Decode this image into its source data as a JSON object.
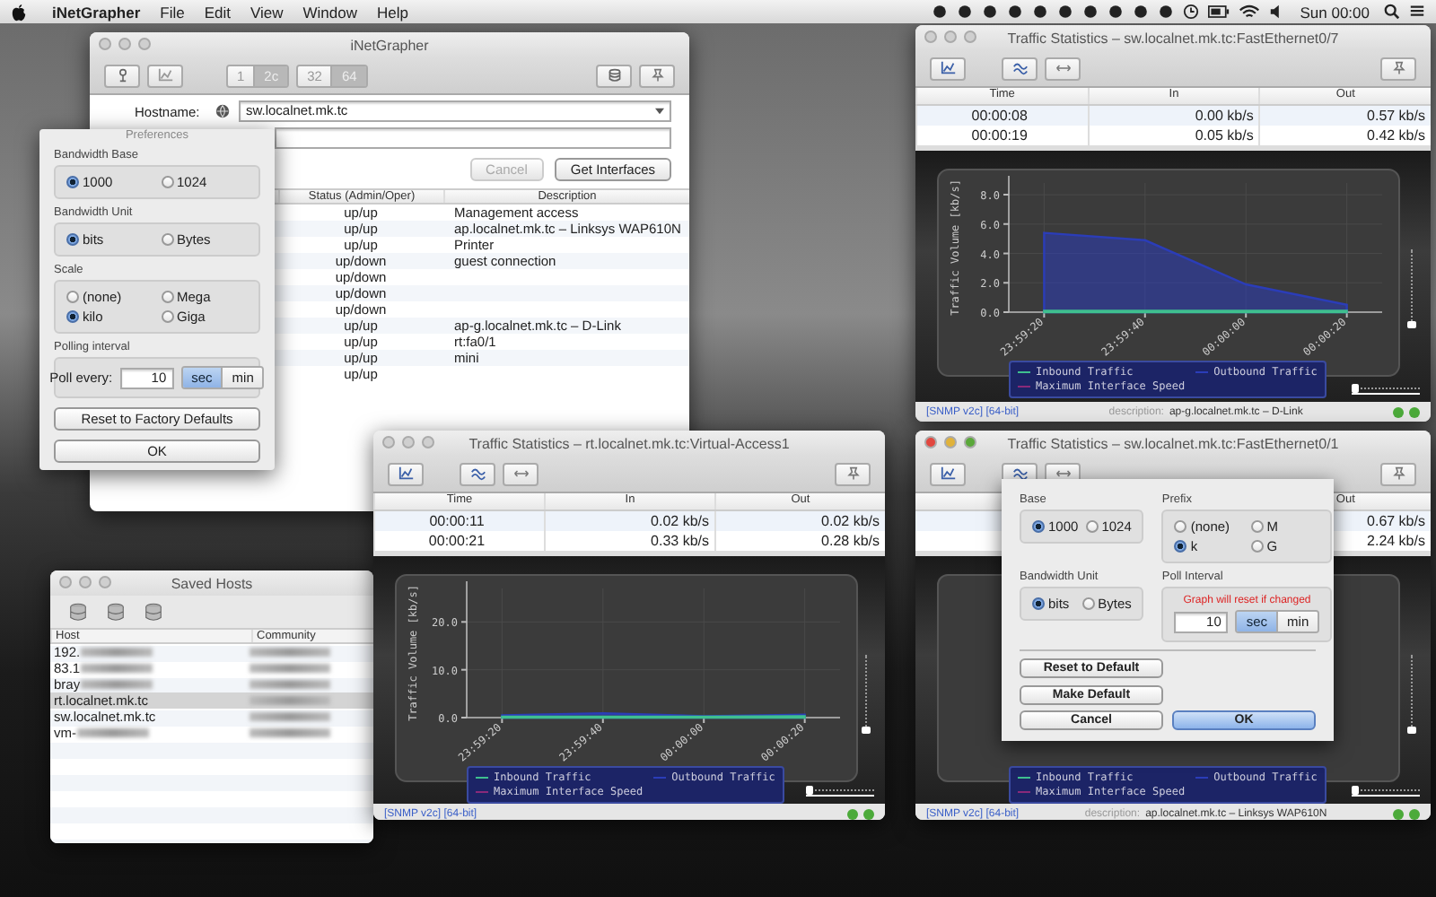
{
  "menu_bar": {
    "app_name": "iNetGrapher",
    "menus": [
      "File",
      "Edit",
      "View",
      "Window",
      "Help"
    ],
    "clock": "Sun 00:00"
  },
  "main_window": {
    "title": "iNetGrapher",
    "version_buttons": [
      {
        "label": "1",
        "selected": false
      },
      {
        "label": "2c",
        "selected": true
      }
    ],
    "bit_buttons": [
      {
        "label": "32",
        "selected": false
      },
      {
        "label": "64",
        "selected": true
      }
    ],
    "hostname_label": "Hostname:",
    "hostname": "sw.localnet.mk.tc",
    "buttons": [
      {
        "label": "Cancel",
        "disabled": true
      },
      {
        "label": "Get Interfaces",
        "disabled": false
      }
    ],
    "columns": [
      "Status (Admin/Oper)",
      "Description"
    ],
    "rows": [
      {
        "status": "up/up",
        "description": "Management access"
      },
      {
        "status": "up/up",
        "description": "ap.localnet.mk.tc – Linksys WAP610N"
      },
      {
        "status": "up/up",
        "description": "Printer"
      },
      {
        "status": "up/down",
        "description": "guest connection"
      },
      {
        "status": "up/down"
      },
      {
        "status": "up/down"
      },
      {
        "status": "up/down"
      },
      {
        "status": "up/up",
        "description": "ap-g.localnet.mk.tc – D-Link"
      },
      {
        "status": "up/up",
        "description": "rt:fa0/1"
      },
      {
        "status": "up/up",
        "description": "mini"
      },
      {
        "status": "up/up"
      }
    ]
  },
  "preferences": {
    "title": "Preferences",
    "groups": [
      {
        "kind": "radio",
        "title": "Bandwidth Base",
        "options": [
          {
            "label": "1000",
            "selected": true
          },
          {
            "label": "1024",
            "selected": false
          }
        ]
      },
      {
        "kind": "radio",
        "title": "Bandwidth Unit",
        "options": [
          {
            "label": "bits",
            "selected": true
          },
          {
            "label": "Bytes",
            "selected": false
          }
        ]
      },
      {
        "kind": "radio",
        "title": "Scale",
        "options": [
          {
            "label": "(none)",
            "selected": false
          },
          {
            "label": "Mega",
            "selected": false
          },
          {
            "label": "kilo",
            "selected": true
          },
          {
            "label": "Giga",
            "selected": false
          }
        ]
      },
      {
        "kind": "interval",
        "title": "Polling interval",
        "label": "Poll every:",
        "value": "10",
        "units": [
          {
            "label": "sec",
            "selected": true
          },
          {
            "label": "min",
            "selected": false
          }
        ]
      }
    ],
    "buttons": [
      "Reset to Factory Defaults",
      "OK"
    ]
  },
  "saved_hosts": {
    "title": "Saved Hosts",
    "columns": [
      "Host",
      "Community"
    ],
    "rows": [
      {
        "host": "192.",
        "host_blurred": true,
        "selected": false
      },
      {
        "host": "83.1",
        "host_blurred": true,
        "selected": false
      },
      {
        "host": "bray",
        "host_blurred": true,
        "selected": false
      },
      {
        "host": "rt.localnet.mk.tc",
        "host_blurred": false,
        "selected": true
      },
      {
        "host": "sw.localnet.mk.tc",
        "host_blurred": false,
        "selected": false
      },
      {
        "host": "vm-",
        "host_blurred": true,
        "selected": false
      }
    ]
  },
  "traffic_windows": [
    {
      "title": "Traffic Statistics – sw.localnet.mk.tc:FastEthernet0/7",
      "active": false,
      "columns": [
        "Time",
        "In",
        "Out"
      ],
      "rows": [
        [
          "00:00:08",
          "0.00 kb/s",
          "0.57 kb/s"
        ],
        [
          "00:00:19",
          "0.05 kb/s",
          "0.42 kb/s"
        ]
      ],
      "chart_data": {
        "type": "area",
        "ylabel": "Traffic Volume [kb/s]",
        "grid": true,
        "legend": "bottom",
        "categories": [
          "23:59:20",
          "23:59:40",
          "00:00:00",
          "00:00:20"
        ],
        "ylim": [
          0,
          8.8
        ],
        "yticks": [
          {
            "value": 0,
            "label": "0.0"
          },
          {
            "value": 2,
            "label": "2.0"
          },
          {
            "value": 4,
            "label": "4.0"
          },
          {
            "value": 6,
            "label": "6.0"
          },
          {
            "value": 8,
            "label": "8.0"
          }
        ],
        "series": [
          {
            "name": "Inbound Traffic",
            "color": "#3fbf8f",
            "values": [
              0.1,
              0.1,
              0.1,
              0.1
            ]
          },
          {
            "name": "Outbound Traffic",
            "color": "#2b3db8",
            "values": [
              5.4,
              4.9,
              1.9,
              0.5
            ]
          },
          {
            "name": "Maximum Interface Speed",
            "color": "#8a2a7a",
            "values": [
              null,
              null,
              null,
              null
            ]
          }
        ]
      },
      "vertical_slider": {
        "level": 0
      },
      "horizontal_slider": {
        "level": 0
      },
      "snmp": "[SNMP v2c] [64-bit]",
      "description_label": "description:",
      "description": "ap-g.localnet.mk.tc – D-Link"
    },
    {
      "title": "Traffic Statistics – rt.localnet.mk.tc:Virtual-Access1",
      "active": false,
      "columns": [
        "Time",
        "In",
        "Out"
      ],
      "rows": [
        [
          "00:00:11",
          "0.02 kb/s",
          "0.02 kb/s"
        ],
        [
          "00:00:21",
          "0.33 kb/s",
          "0.28 kb/s"
        ]
      ],
      "chart_data": {
        "type": "area",
        "ylabel": "Traffic Volume [kb/s]",
        "grid": true,
        "legend": "bottom",
        "categories": [
          "23:59:20",
          "23:59:40",
          "00:00:00",
          "00:00:20"
        ],
        "ylim": [
          0,
          27
        ],
        "yticks": [
          {
            "value": 0,
            "label": "0.0"
          },
          {
            "value": 10,
            "label": "10.0"
          },
          {
            "value": 20,
            "label": "20.0"
          }
        ],
        "series": [
          {
            "name": "Inbound Traffic",
            "color": "#3fbf8f",
            "values": [
              0.2,
              0.2,
              0.2,
              0.3
            ]
          },
          {
            "name": "Outbound Traffic",
            "color": "#2b3db8",
            "values": [
              0.5,
              0.9,
              0.3,
              0.6
            ]
          },
          {
            "name": "Maximum Interface Speed",
            "color": "#8a2a7a",
            "values": [
              null,
              null,
              null,
              null
            ]
          }
        ]
      },
      "vertical_slider": {
        "level": 0
      },
      "horizontal_slider": {
        "level": 0
      },
      "snmp": "[SNMP v2c] [64-bit]"
    },
    {
      "title": "Traffic Statistics – sw.localnet.mk.tc:FastEthernet0/1",
      "active": true,
      "columns": [
        "Out"
      ],
      "rows": [
        [
          "0.67 kb/s"
        ],
        [
          "2.24 kb/s"
        ]
      ],
      "legend": [
        {
          "name": "Inbound Traffic",
          "color": "#3fbf8f"
        },
        {
          "name": "Outbound Traffic",
          "color": "#2b3db8"
        },
        {
          "name": "Maximum Interface Speed",
          "color": "#8a2a7a"
        }
      ],
      "vertical_slider": {
        "level": 0
      },
      "horizontal_slider": {
        "level": 0
      },
      "snmp": "[SNMP v2c] [64-bit]",
      "description_label": "description:",
      "description": "ap.localnet.mk.tc – Linksys WAP610N",
      "sheet": {
        "groups": [
          {
            "kind": "radio",
            "title": "Base",
            "options": [
              {
                "label": "1000",
                "selected": true
              },
              {
                "label": "1024",
                "selected": false
              }
            ]
          },
          {
            "kind": "radio",
            "title": "Prefix",
            "options": [
              {
                "label": "(none)",
                "selected": false
              },
              {
                "label": "M",
                "selected": false
              },
              {
                "label": "k",
                "selected": true
              },
              {
                "label": "G",
                "selected": false
              }
            ]
          },
          {
            "kind": "radio",
            "title": "Bandwidth Unit",
            "options": [
              {
                "label": "bits",
                "selected": true
              },
              {
                "label": "Bytes",
                "selected": false
              }
            ]
          },
          {
            "kind": "interval",
            "title": "Poll Interval",
            "warning": "Graph will reset if changed",
            "value": "10",
            "units": [
              {
                "label": "sec",
                "selected": true
              },
              {
                "label": "min",
                "selected": false
              }
            ]
          }
        ],
        "buttons": [
          {
            "label": "Reset to Default",
            "default": false
          },
          {
            "label": "Make Default",
            "default": false
          },
          {
            "label": "Cancel",
            "default": false
          },
          {
            "label": "OK",
            "default": true
          }
        ]
      }
    }
  ]
}
